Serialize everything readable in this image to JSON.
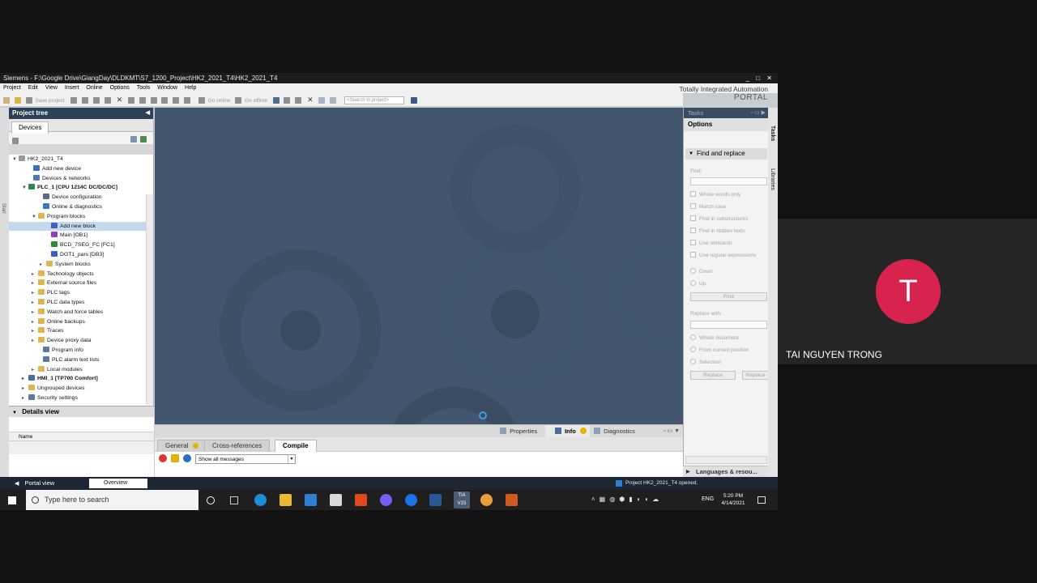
{
  "window": {
    "title": "Siemens  -  F:\\Google Drive\\GiangDay\\DLDKMT\\S7_1200_Project\\HK2_2021_T4\\HK2_2021_T4",
    "controls": "_ □ ✕"
  },
  "menu": [
    "Project",
    "Edit",
    "View",
    "Insert",
    "Online",
    "Options",
    "Tools",
    "Window",
    "Help"
  ],
  "toolbar": {
    "save_project": "Save project",
    "go_online": "Go online",
    "go_offline": "Go offline",
    "search_placeholder": "<Search in project>"
  },
  "brand": {
    "line1": "Totally Integrated Automation",
    "line2": "PORTAL"
  },
  "project_tree": {
    "title": "Project tree",
    "tab": "Devices",
    "left_strip": "Start",
    "items": [
      {
        "label": "HK2_2021_T4",
        "exp": "▼",
        "icon": "project-icon",
        "color": "#9a9a9a"
      },
      {
        "label": "Add new device",
        "exp": "",
        "icon": "add-device-icon",
        "color": "#3d6fb8"
      },
      {
        "label": "Devices & networks",
        "exp": "",
        "icon": "network-icon",
        "color": "#4a7db8"
      },
      {
        "label": "PLC_1 [CPU 1214C DC/DC/DC]",
        "exp": "▼",
        "icon": "plc-icon",
        "color": "#2d8a4a"
      },
      {
        "label": "Device configuration",
        "exp": "",
        "icon": "device-config-icon",
        "color": "#5d6c7c"
      },
      {
        "label": "Online & diagnostics",
        "exp": "",
        "icon": "diagnostics-icon",
        "color": "#3b78c2"
      },
      {
        "label": "Program blocks",
        "exp": "▼",
        "icon": "folder-icon",
        "color": "#e3b34d"
      },
      {
        "label": "Add new block",
        "exp": "",
        "icon": "add-block-icon",
        "color": "#3f5fb8"
      },
      {
        "label": "Main [OB1]",
        "exp": "",
        "icon": "ob-icon",
        "color": "#8a3ec2"
      },
      {
        "label": "BCD_7SEG_FC [FC1]",
        "exp": "",
        "icon": "fc-icon",
        "color": "#2e8b3d"
      },
      {
        "label": "DGT1_pars [DB3]",
        "exp": "",
        "icon": "db-icon",
        "color": "#3d5fbf"
      },
      {
        "label": "System blocks",
        "exp": "▸",
        "icon": "folder-icon",
        "color": "#e3b34d"
      },
      {
        "label": "Technology objects",
        "exp": "▸",
        "icon": "folder-icon",
        "color": "#e3b34d"
      },
      {
        "label": "External source files",
        "exp": "▸",
        "icon": "folder-icon",
        "color": "#e3b34d"
      },
      {
        "label": "PLC tags",
        "exp": "▸",
        "icon": "folder-icon",
        "color": "#e3b34d"
      },
      {
        "label": "PLC data types",
        "exp": "▸",
        "icon": "folder-icon",
        "color": "#e3b34d"
      },
      {
        "label": "Watch and force tables",
        "exp": "▸",
        "icon": "folder-icon",
        "color": "#e3b34d"
      },
      {
        "label": "Online backups",
        "exp": "▸",
        "icon": "folder-icon",
        "color": "#e3b34d"
      },
      {
        "label": "Traces",
        "exp": "▸",
        "icon": "folder-icon",
        "color": "#e3b34d"
      },
      {
        "label": "Device proxy data",
        "exp": "▸",
        "icon": "folder-icon",
        "color": "#e3b34d"
      },
      {
        "label": "Program info",
        "exp": "",
        "icon": "program-info-icon",
        "color": "#5a7aa0"
      },
      {
        "label": "PLC alarm text lists",
        "exp": "",
        "icon": "alarm-list-icon",
        "color": "#5a7aa0"
      },
      {
        "label": "Local modules",
        "exp": "▸",
        "icon": "folder-icon",
        "color": "#e3b34d"
      },
      {
        "label": "HMI_1 [TP700 Comfort]",
        "exp": "▸",
        "icon": "hmi-icon",
        "color": "#4e6f95"
      },
      {
        "label": "Ungrouped devices",
        "exp": "▸",
        "icon": "folder-icon",
        "color": "#e3b34d"
      },
      {
        "label": "Security settings",
        "exp": "▸",
        "icon": "security-icon",
        "color": "#5a7aa0"
      }
    ]
  },
  "details_view": {
    "title": "Details view",
    "column": "Name"
  },
  "inspector": {
    "tabs": [
      "Properties",
      "Info",
      "Diagnostics"
    ],
    "subtabs": [
      "General",
      "Cross-references",
      "Compile"
    ],
    "filter": "Show all messages"
  },
  "tasks": {
    "title": "Tasks",
    "options": "Options",
    "section": "Find and replace",
    "find_label": "Find:",
    "checkboxes": [
      "Whole words only",
      "Match case",
      "Find in substructures",
      "Find in hidden texts",
      "Use wildcards",
      "Use regular expressions"
    ],
    "direction": [
      "Down",
      "Up"
    ],
    "find_button": "Find",
    "replace_label": "Replace with:",
    "scope": [
      "Whole document",
      "From current position",
      "Selection"
    ],
    "replace_button": "Replace",
    "replace_all_button": "Replace",
    "languages": "Languages & resou...",
    "side_tabs": [
      "Tasks",
      "Libraries"
    ]
  },
  "portal_bar": {
    "portal_view": "Portal view",
    "overview": "Overview",
    "status": "Project HK2_2021_T4 opened."
  },
  "taskbar": {
    "search_placeholder": "Type here to search",
    "time": "5:20 PM",
    "date": "4/14/2021",
    "lang": "ENG"
  },
  "participant": {
    "initial": "T",
    "name": "TAI NGUYEN TRONG",
    "avatar_color": "#d8234f"
  }
}
